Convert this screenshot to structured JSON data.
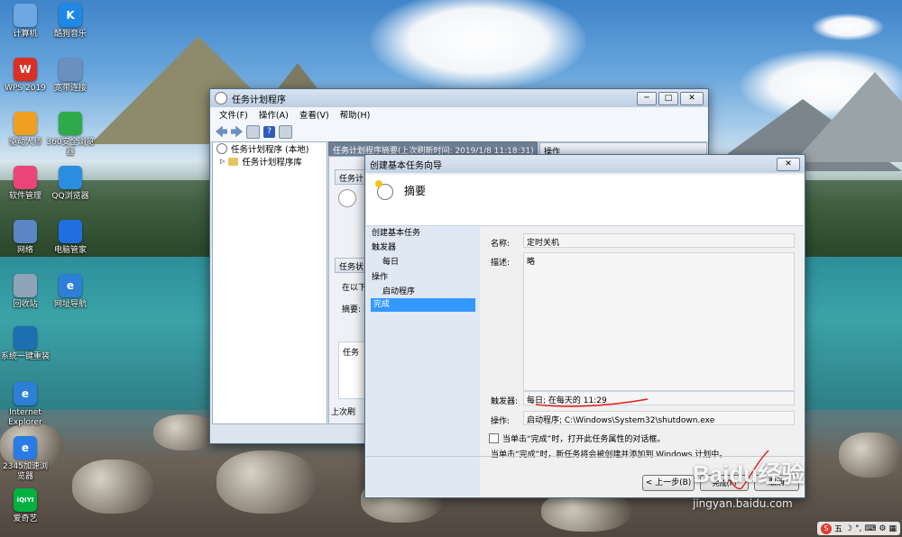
{
  "desktop_icons": [
    {
      "label": "计算机",
      "icon": "computer-icon",
      "color": "#6fa7e0"
    },
    {
      "label": "酷狗音乐",
      "icon": "kugou-icon",
      "color": "#1e88e5",
      "glyph": "K"
    },
    {
      "label": "WPS 2019",
      "icon": "wps-icon",
      "color": "#d93025",
      "glyph": "W"
    },
    {
      "label": "宽带连接",
      "icon": "broadband-icon",
      "color": "#6b8fbf"
    },
    {
      "label": "驱动大师",
      "icon": "driver-icon",
      "color": "#f0a020"
    },
    {
      "label": "360安全浏览器",
      "icon": "360-browser-icon",
      "color": "#2eaa4a"
    },
    {
      "label": "软件管理",
      "icon": "software-manager-icon",
      "color": "#e9457a"
    },
    {
      "label": "QQ浏览器",
      "icon": "qq-browser-icon",
      "color": "#2a8de0"
    },
    {
      "label": "网络",
      "icon": "network-icon",
      "color": "#5a86c4"
    },
    {
      "label": "电脑管家",
      "icon": "pc-manager-icon",
      "color": "#1f6fe0"
    },
    {
      "label": "回收站",
      "icon": "recycle-bin-icon",
      "color": "#8fa3b8"
    },
    {
      "label": "网址导航",
      "icon": "ie-nav-icon",
      "color": "#2d7fd8",
      "glyph": "e"
    },
    {
      "label": "系统一键重装",
      "icon": "reinstall-icon",
      "color": "#1c6fb0"
    },
    {
      "label": "Internet Explorer",
      "icon": "ie-icon",
      "color": "#2d7fd8",
      "glyph": "e"
    },
    {
      "label": "2345加速浏览器",
      "icon": "2345-browser-icon",
      "color": "#2a7be4",
      "glyph": "e"
    },
    {
      "label": "爱奇艺",
      "icon": "iqiyi-icon",
      "color": "#00b140",
      "glyph": "iQIYI"
    }
  ],
  "task_scheduler": {
    "title": "任务计划程序",
    "menu": [
      "文件(F)",
      "操作(A)",
      "查看(V)",
      "帮助(H)"
    ],
    "tree": {
      "root": "任务计划程序 (本地)",
      "child": "任务计划程序库"
    },
    "summary_header": "任务计划程序摘要(上次刷新时间: 2019/1/8 11:18:31)",
    "actions_header": "操作",
    "section1": "任务计",
    "section2": "任务状",
    "status_prefix": "在以下",
    "summary_label": "摘要:",
    "task_label": "任务",
    "last_refresh": "上次刷"
  },
  "wizard": {
    "title": "创建基本任务向导",
    "heading": "摘要",
    "nav": [
      "创建基本任务",
      "触发器",
      "每日",
      "操作",
      "启动程序",
      "完成"
    ],
    "selected_nav": "完成",
    "name_label": "名称:",
    "name_value": "定时关机",
    "desc_label": "描述:",
    "desc_value": "略",
    "trigger_label": "触发器:",
    "trigger_value": "每日; 在每天的 11:29",
    "action_label": "操作:",
    "action_value": "启动程序; C:\\Windows\\System32\\shutdown.exe",
    "checkbox_label": "当单击“完成”时，打开此任务属性的对话框。",
    "note": "当单击“完成”时，新任务将会被创建并添加到 Windows 计划中。",
    "back_button": "< 上一步(B)",
    "finish_button": "完成(F)",
    "cancel_button": "取消"
  },
  "watermark": {
    "brand": "Baidu",
    "suffix": "经验",
    "url": "jingyan.baidu.com"
  },
  "tray": {
    "ime": "五",
    "items": [
      "☽",
      "°,",
      "⌨",
      "⚙",
      "▦"
    ]
  }
}
